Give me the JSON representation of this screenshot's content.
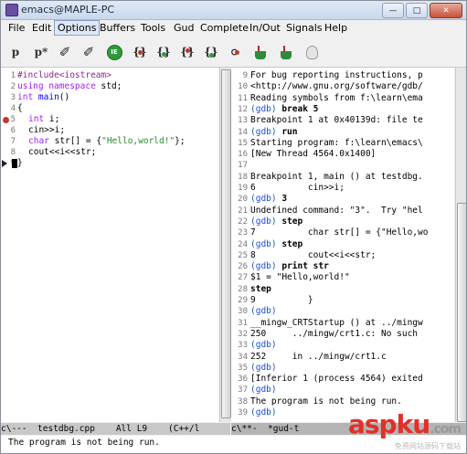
{
  "window": {
    "title": "emacs@MAPLE-PC",
    "min": "—",
    "max": "□",
    "close": "✕"
  },
  "menubar": [
    "File",
    "Edit",
    "Options",
    "Buffers",
    "Tools",
    "Gud",
    "Complete",
    "In/Out",
    "Signals",
    "Help"
  ],
  "toolbar": {
    "p_label": "p",
    "pstar_label": "p*",
    "pen": "✐",
    "go_label": "IE"
  },
  "source": {
    "lines": [
      {
        "num": "1",
        "text": "#include<iostream>"
      },
      {
        "num": "2",
        "kw": "using namespace",
        "rest": " std;"
      },
      {
        "num": "3",
        "kw": "int",
        "rest": " ",
        "fn": "main",
        "tail": "()"
      },
      {
        "num": "4",
        "text": "{"
      },
      {
        "num": "5",
        "kw": "int",
        "rest": " i;"
      },
      {
        "num": "6",
        "text": "cin>>i;"
      },
      {
        "num": "7",
        "kw": "char",
        "rest": " str[] = {",
        "str": "\"Hello,world!\"",
        "tail": "};"
      },
      {
        "num": "8",
        "text": "cout<<i<<str;"
      },
      {
        "num": "9",
        "text": "}"
      }
    ]
  },
  "gdb": {
    "lines": [
      {
        "num": "9",
        "text": "For bug reporting instructions, p"
      },
      {
        "num": "10",
        "text": "<http://www.gnu.org/software/gdb/"
      },
      {
        "num": "11",
        "text": "Reading symbols from f:\\learn\\ema"
      },
      {
        "num": "12",
        "prompt": "(gdb)",
        "cmd": " break 5"
      },
      {
        "num": "13",
        "text": "Breakpoint 1 at 0x40139d: file te"
      },
      {
        "num": "14",
        "prompt": "(gdb)",
        "cmd": " run"
      },
      {
        "num": "15",
        "text": "Starting program: f:\\learn\\emacs\\"
      },
      {
        "num": "16",
        "text": "[New Thread 4564.0x1400]"
      },
      {
        "num": "17",
        "text": ""
      },
      {
        "num": "18",
        "text": "Breakpoint 1, main () at testdbg."
      },
      {
        "num": "19",
        "text": "6          cin>>i;"
      },
      {
        "num": "20",
        "prompt": "(gdb)",
        "cmd": " 3"
      },
      {
        "num": "21",
        "text": "Undefined command: \"3\".  Try \"hel"
      },
      {
        "num": "22",
        "prompt": "(gdb)",
        "cmd": " step"
      },
      {
        "num": "23",
        "text": "7          char str[] = {\"Hello,wo"
      },
      {
        "num": "24",
        "prompt": "(gdb)",
        "cmd": " step"
      },
      {
        "num": "25",
        "text": "8          cout<<i<<str;"
      },
      {
        "num": "26",
        "prompt": "(gdb)",
        "cmd": " print str"
      },
      {
        "num": "27",
        "text": "$1 = \"Hello,world!\""
      },
      {
        "num": "28",
        "bold": "step"
      },
      {
        "num": "29",
        "text": "9          }"
      },
      {
        "num": "30",
        "prompt": "(gdb)",
        "cmd": ""
      },
      {
        "num": "31",
        "text": "__mingw_CRTStartup () at ../mingw"
      },
      {
        "num": "32",
        "text": "250     ../mingw/crt1.c: No such "
      },
      {
        "num": "33",
        "prompt": "(gdb)",
        "cmd": ""
      },
      {
        "num": "34",
        "text": "252     in ../mingw/crt1.c"
      },
      {
        "num": "35",
        "prompt": "(gdb)",
        "cmd": ""
      },
      {
        "num": "36",
        "text": "[Inferior 1 (process 4564) exited"
      },
      {
        "num": "37",
        "prompt": "(gdb)",
        "cmd": ""
      },
      {
        "num": "38",
        "text": "The program is not being run."
      },
      {
        "num": "39",
        "prompt": "(gdb)",
        "cmd": ""
      }
    ]
  },
  "modeline_left": "c\\---  testdbg.cpp    All L9    (C++/l",
  "modeline_right": "c\\**-  *gud-t",
  "echo": "The program is not being run.",
  "watermark": {
    "main": "asp",
    "ku": "ku",
    "net": ".com",
    "sub": "免费网站源码下载站"
  },
  "colors": {
    "keyword": "#a020f0",
    "string": "#2a8a2a",
    "prompt": "#1a4fd0",
    "breakpoint": "#c0392b"
  }
}
